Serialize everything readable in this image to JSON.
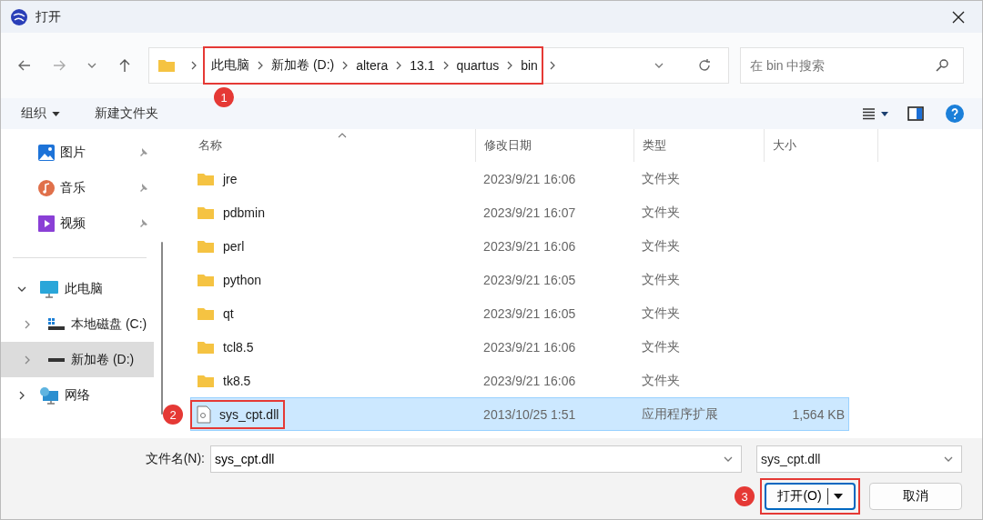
{
  "window": {
    "title": "打开"
  },
  "nav": {
    "breadcrumb": {
      "annotation": "1",
      "items": [
        {
          "label": "此电脑"
        },
        {
          "label": "新加卷 (D:)"
        },
        {
          "label": "altera"
        },
        {
          "label": "13.1"
        },
        {
          "label": "quartus"
        },
        {
          "label": "bin"
        }
      ]
    },
    "search": {
      "placeholder": "在 bin 中搜索"
    }
  },
  "toolbar": {
    "organize": "组织",
    "new_folder": "新建文件夹"
  },
  "sidebar": {
    "items": [
      {
        "label": "图片",
        "kind": "pictures",
        "pinned": true,
        "selected": false
      },
      {
        "label": "音乐",
        "kind": "music",
        "pinned": true,
        "selected": false
      },
      {
        "label": "视频",
        "kind": "videos",
        "pinned": true,
        "selected": false
      },
      {
        "label": "此电脑",
        "kind": "pc",
        "expanded": true,
        "selected": false,
        "children": [
          {
            "label": "本地磁盘 (C:)",
            "kind": "system-drive",
            "expanded": false,
            "selected": false
          },
          {
            "label": "新加卷 (D:)",
            "kind": "drive",
            "expanded": false,
            "selected": true
          }
        ]
      },
      {
        "label": "网络",
        "kind": "network",
        "expanded": false,
        "selected": false
      }
    ]
  },
  "table": {
    "columns": [
      "名称",
      "修改日期",
      "类型",
      "大小"
    ],
    "rows": [
      {
        "kind": "folder",
        "name": "jre",
        "modified": "2023/9/21 16:06",
        "type": "文件夹",
        "selected": false
      },
      {
        "kind": "folder",
        "name": "pdbmin",
        "modified": "2023/9/21 16:07",
        "type": "文件夹",
        "selected": false
      },
      {
        "kind": "folder",
        "name": "perl",
        "modified": "2023/9/21 16:06",
        "type": "文件夹",
        "selected": false
      },
      {
        "kind": "folder",
        "name": "python",
        "modified": "2023/9/21 16:05",
        "type": "文件夹",
        "selected": false
      },
      {
        "kind": "folder",
        "name": "qt",
        "modified": "2023/9/21 16:05",
        "type": "文件夹",
        "selected": false
      },
      {
        "kind": "folder",
        "name": "tcl8.5",
        "modified": "2023/9/21 16:06",
        "type": "文件夹",
        "selected": false
      },
      {
        "kind": "folder",
        "name": "tk8.5",
        "modified": "2023/9/21 16:06",
        "type": "文件夹",
        "selected": false
      },
      {
        "kind": "file",
        "name": "sys_cpt.dll",
        "modified": "2013/10/25 1:51",
        "type": "应用程序扩展",
        "size": "1,564 KB",
        "selected": true,
        "annotation": "2"
      }
    ]
  },
  "footer": {
    "filename_label": "文件名(N):",
    "filename": "sys_cpt.dll",
    "filter": "sys_cpt.dll",
    "open_button": {
      "label": "打开(O)",
      "annotation": "3"
    },
    "cancel_button": "取消"
  }
}
